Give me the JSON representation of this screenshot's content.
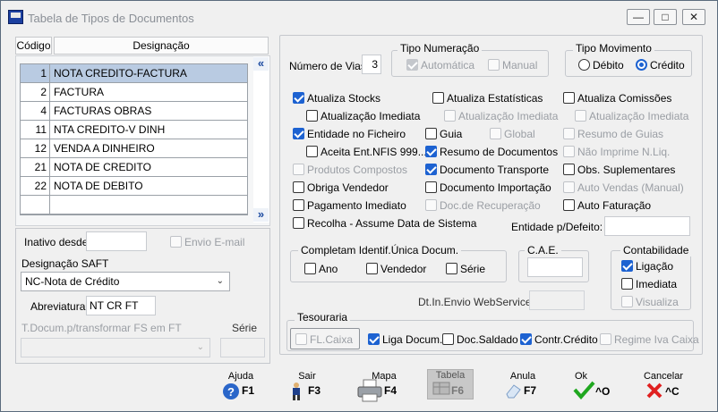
{
  "window": {
    "title": "Tabela de Tipos de Documentos"
  },
  "grid": {
    "col_code": "Código",
    "col_desc": "Designação",
    "rows": [
      {
        "code": "1",
        "desc": "NOTA CREDITO-FACTURA"
      },
      {
        "code": "2",
        "desc": "FACTURA"
      },
      {
        "code": "4",
        "desc": "FACTURAS OBRAS"
      },
      {
        "code": "11",
        "desc": "NTA CREDITO-V DINH"
      },
      {
        "code": "12",
        "desc": "VENDA A DINHEIRO"
      },
      {
        "code": "21",
        "desc": "NOTA DE CREDITO"
      },
      {
        "code": "22",
        "desc": "NOTA DE DEBITO"
      },
      {
        "code": "",
        "desc": ""
      }
    ]
  },
  "left": {
    "inativo_label": "Inativo desde",
    "inativo_value": "",
    "envio_email": "Envio E-mail",
    "designacao_saft_label": "Designação SAFT",
    "designacao_saft_value": "NC-Nota de Crédito",
    "abreviatura_label": "Abreviatura:",
    "abreviatura_value": "NT CR FT",
    "transformar_label": "T.Docum.p/transformar FS em FT",
    "serie_label": "Série",
    "transformar_value": "",
    "serie_value": ""
  },
  "right": {
    "num_vias_label": "Número de Vias:",
    "num_vias_value": "3",
    "tipo_numeracao_title": "Tipo Numeração",
    "automatica": "Automática",
    "manual": "Manual",
    "tipo_movimento_title": "Tipo Movimento",
    "debito": "Débito",
    "credito": "Crédito",
    "atualiza_stocks": "Atualiza Stocks",
    "atualizacao_imediata_1": "Atualização Imediata",
    "entidade_ficheiro": "Entidade no Ficheiro",
    "aceita_ent": "Aceita Ent.NFIS 999...",
    "produtos_compostos": "Produtos Compostos",
    "obriga_vendedor": "Obriga Vendedor",
    "pagamento_imediato": "Pagamento Imediato",
    "recolha": "Recolha - Assume Data de Sistema",
    "atualiza_estatisticas": "Atualiza Estatísticas",
    "atualizacao_imediata_2": "Atualização Imediata",
    "guia": "Guia",
    "global": "Global",
    "resumo_documentos": "Resumo de Documentos",
    "documento_transporte": "Documento Transporte",
    "documento_importacao": "Documento Importação",
    "doc_recuperacao": "Doc.de Recuperação",
    "atualiza_comissoes": "Atualiza Comissões",
    "atualizacao_imediata_3": "Atualização Imediata",
    "resumo_guias": "Resumo de Guias",
    "nao_imprime": "Não Imprime N.Liq.",
    "obs_suplementares": "Obs. Suplementares",
    "auto_vendas": "Auto Vendas (Manual)",
    "auto_faturacao": "Auto Faturação",
    "entidade_defeito_label": "Entidade p/Defeito:",
    "entidade_defeito_value": "",
    "completam_title": "Completam Identif.Única Docum.",
    "ano": "Ano",
    "vendedor": "Vendedor",
    "serie": "Série",
    "cae_title": "C.A.E.",
    "cae_value": "",
    "contabilidade_title": "Contabilidade",
    "ligacao": "Ligação",
    "imediata": "Imediata",
    "visualiza": "Visualiza",
    "dt_envio_label": "Dt.In.Envio WebService",
    "dt_envio_value": "",
    "tesouraria_title": "Tesouraria",
    "fl_caixa": "FL.Caixa",
    "liga_docum": "Liga Docum.",
    "doc_saldado": "Doc.Saldado",
    "contr_credito": "Contr.Crédito",
    "regime_iva": "Regime Iva Caixa"
  },
  "toolbar": [
    {
      "caption": "Ajuda",
      "key": "F1"
    },
    {
      "caption": "Sair",
      "key": "F3"
    },
    {
      "caption": "Mapa",
      "key": "F4"
    },
    {
      "caption": "Tabela",
      "key": "F6"
    },
    {
      "caption": "Anula",
      "key": "F7"
    },
    {
      "caption": "Ok",
      "key": "^O"
    },
    {
      "caption": "Cancelar",
      "key": "^C"
    }
  ]
}
